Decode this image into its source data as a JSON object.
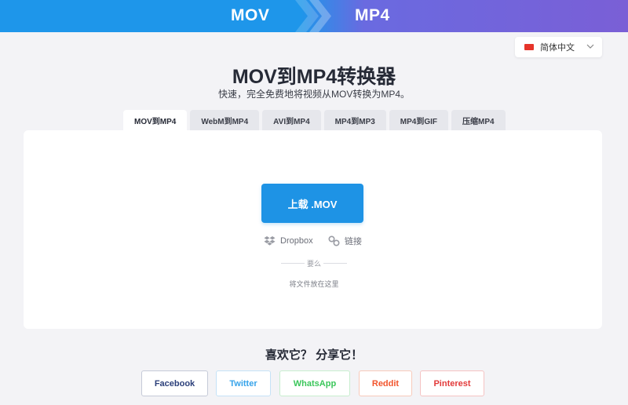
{
  "banner": {
    "from": "MOV",
    "to": "MP4"
  },
  "language": {
    "selected": "简体中文",
    "flag_color": "#e6342a"
  },
  "header": {
    "title": "MOV到MP4转换器",
    "subtitle": "快速，完全免费地将视频从MOV转换为MP4。"
  },
  "tabs": [
    {
      "label": "MOV到MP4",
      "active": true
    },
    {
      "label": "WebM到MP4",
      "active": false
    },
    {
      "label": "AVI到MP4",
      "active": false
    },
    {
      "label": "MP4到MP3",
      "active": false
    },
    {
      "label": "MP4到GIF",
      "active": false
    },
    {
      "label": "压缩MP4",
      "active": false
    }
  ],
  "uploader": {
    "upload_label": "上载 .MOV",
    "dropbox_label": "Dropbox",
    "link_label": "链接",
    "or_label": "要么",
    "drop_hint": "将文件放在这里"
  },
  "share": {
    "title": "喜欢它？ 分享它！",
    "buttons": [
      {
        "label": "Facebook",
        "color": "#2b3f7a"
      },
      {
        "label": "Twitter",
        "color": "#36a3ea"
      },
      {
        "label": "WhatsApp",
        "color": "#3ac65a"
      },
      {
        "label": "Reddit",
        "color": "#f2542c"
      },
      {
        "label": "Pinterest",
        "color": "#e23a3a"
      }
    ]
  },
  "colors": {
    "accent": "#1e93e5",
    "banner_left": "#1e96ea",
    "banner_right": "#7a5fd6",
    "background": "#f3f3f6"
  }
}
